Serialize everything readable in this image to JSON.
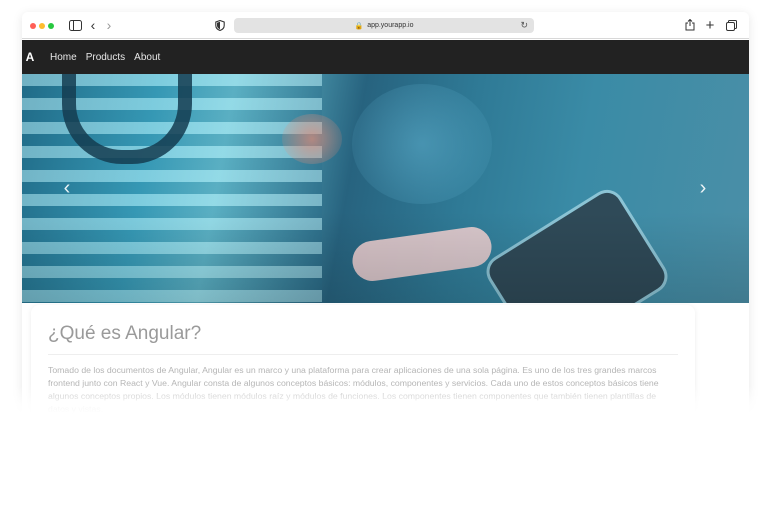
{
  "browser": {
    "url": "app.yourapp.io"
  },
  "navbar": {
    "logo_text": "A",
    "links": [
      "Home",
      "Products",
      "About"
    ]
  },
  "carousel": {
    "prev_icon": "chevron-left-icon",
    "next_icon": "chevron-right-icon"
  },
  "card": {
    "title": "¿Qué es Angular?",
    "body": "Tomado de los documentos de Angular, Angular es un marco y una plataforma para crear aplicaciones de una sola página. Es uno de los tres grandes marcos frontend junto con React y Vue. Angular consta de algunos conceptos básicos: módulos, componentes y servicios. Cada uno de estos conceptos básicos tiene algunos conceptos propios. Los módulos tienen módulos raíz y módulos de funciones. Los componentes tienen componentes que también tienen plantillas de datos y vistas."
  }
}
